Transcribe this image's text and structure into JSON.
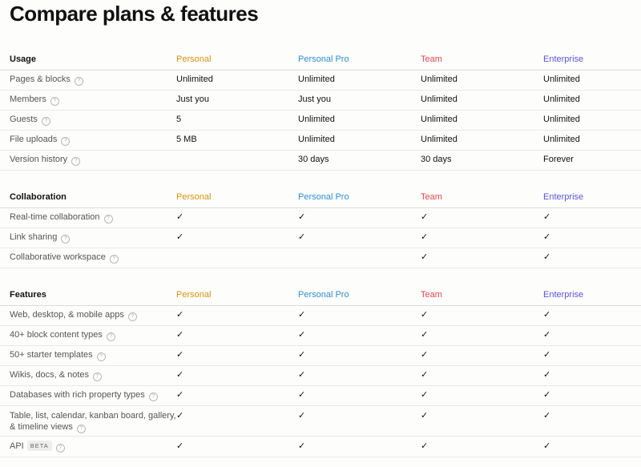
{
  "title": "Compare plans & features",
  "colors": {
    "personal": "#d9930d",
    "personal_pro": "#2f8fd0",
    "team": "#e0484d",
    "enterprise": "#5a54d6",
    "divider": "#e9e9e7"
  },
  "plans": {
    "personal": "Personal",
    "personal_pro": "Personal Pro",
    "team": "Team",
    "enterprise": "Enterprise"
  },
  "check_symbol": "✓",
  "help_icon_glyph": "?",
  "sections": {
    "usage": {
      "title": "Usage",
      "rows": [
        {
          "feature": "Pages & blocks",
          "values": [
            "Unlimited",
            "Unlimited",
            "Unlimited",
            "Unlimited"
          ]
        },
        {
          "feature": "Members",
          "values": [
            "Just you",
            "Just you",
            "Unlimited",
            "Unlimited"
          ]
        },
        {
          "feature": "Guests",
          "values": [
            "5",
            "Unlimited",
            "Unlimited",
            "Unlimited"
          ]
        },
        {
          "feature": "File uploads",
          "values": [
            "5 MB",
            "Unlimited",
            "Unlimited",
            "Unlimited"
          ]
        },
        {
          "feature": "Version history",
          "values": [
            "",
            "30 days",
            "30 days",
            "Forever"
          ]
        }
      ]
    },
    "collaboration": {
      "title": "Collaboration",
      "rows": [
        {
          "feature": "Real-time collaboration",
          "checks": [
            true,
            true,
            true,
            true
          ]
        },
        {
          "feature": "Link sharing",
          "checks": [
            true,
            true,
            true,
            true
          ]
        },
        {
          "feature": "Collaborative workspace",
          "checks": [
            false,
            false,
            true,
            true
          ]
        }
      ]
    },
    "features": {
      "title": "Features",
      "rows": [
        {
          "feature": "Web, desktop, & mobile apps",
          "checks": [
            true,
            true,
            true,
            true
          ]
        },
        {
          "feature": "40+ block content types",
          "checks": [
            true,
            true,
            true,
            true
          ]
        },
        {
          "feature": "50+ starter templates",
          "checks": [
            true,
            true,
            true,
            true
          ]
        },
        {
          "feature": "Wikis, docs, & notes",
          "checks": [
            true,
            true,
            true,
            true
          ]
        },
        {
          "feature": "Databases with rich property types",
          "checks": [
            true,
            true,
            true,
            true
          ]
        },
        {
          "feature_line1": "Table, list, calendar, kanban board, gallery,",
          "feature_line2": "& timeline views",
          "checks": [
            true,
            true,
            true,
            true
          ]
        },
        {
          "feature": "API",
          "badge": "BETA",
          "checks": [
            true,
            true,
            true,
            true
          ]
        }
      ]
    }
  }
}
